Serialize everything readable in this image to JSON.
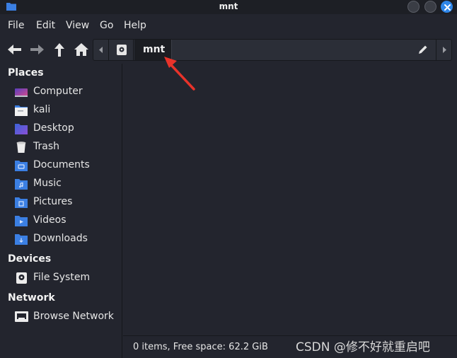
{
  "window": {
    "title": "mnt"
  },
  "menu": [
    "File",
    "Edit",
    "View",
    "Go",
    "Help"
  ],
  "pathbar": {
    "current": "mnt"
  },
  "sidebar": {
    "places_heading": "Places",
    "places": [
      {
        "label": "Computer",
        "icon": "computer-icon"
      },
      {
        "label": "kali",
        "icon": "home-folder-icon"
      },
      {
        "label": "Desktop",
        "icon": "desktop-icon"
      },
      {
        "label": "Trash",
        "icon": "trash-icon"
      },
      {
        "label": "Documents",
        "icon": "documents-folder-icon"
      },
      {
        "label": "Music",
        "icon": "music-folder-icon"
      },
      {
        "label": "Pictures",
        "icon": "pictures-folder-icon"
      },
      {
        "label": "Videos",
        "icon": "videos-folder-icon"
      },
      {
        "label": "Downloads",
        "icon": "downloads-folder-icon"
      }
    ],
    "devices_heading": "Devices",
    "devices": [
      {
        "label": "File System",
        "icon": "drive-icon"
      }
    ],
    "network_heading": "Network",
    "network": [
      {
        "label": "Browse Network",
        "icon": "network-icon"
      }
    ]
  },
  "status": {
    "text": "0 items, Free space: 62.2 GiB"
  },
  "watermark": "CSDN @修不好就重启吧",
  "colors": {
    "background": "#23252e",
    "accent": "#2f86e8",
    "folder_blue": "#3b7fe3",
    "annotation_red": "#e8332a"
  }
}
